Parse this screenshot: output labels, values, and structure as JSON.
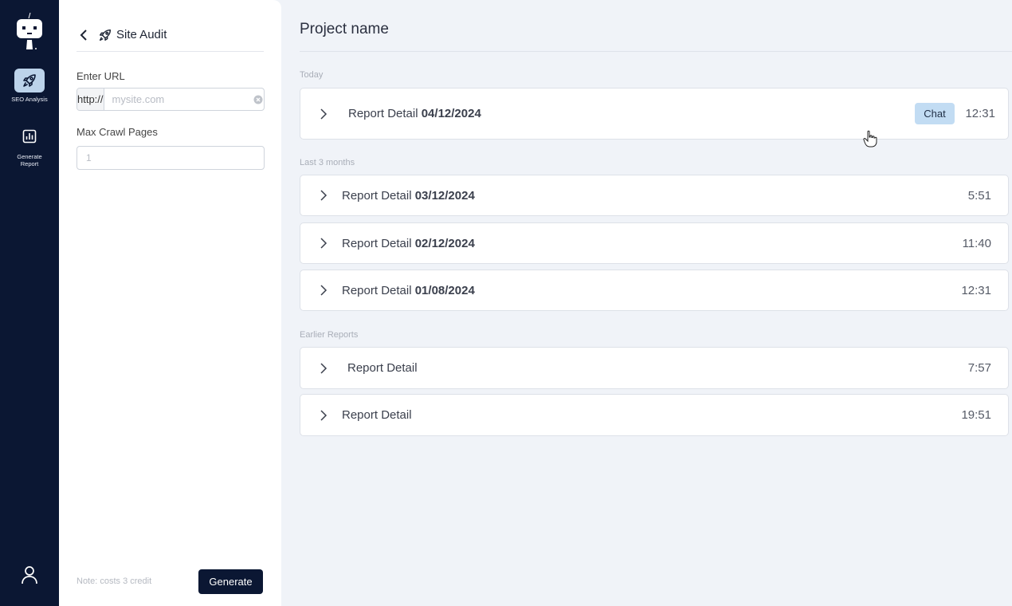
{
  "rail": {
    "items": [
      {
        "label": "SEO Analysis",
        "icon": "rocket-icon"
      },
      {
        "label": "Generate Report",
        "icon": "bar-chart-icon"
      }
    ],
    "user_icon": "user-icon",
    "accent": "#bcd3ea",
    "background": "#0b1733"
  },
  "panel": {
    "title": "Site Audit",
    "url_label": "Enter URL",
    "url_prefix": "http://",
    "url_placeholder": "mysite.com",
    "url_value": "",
    "crawl_label": "Max Crawl Pages",
    "crawl_placeholder": "1",
    "note": "Note: costs 3 credit",
    "generate_label": "Generate"
  },
  "main": {
    "title": "Project name",
    "sections": [
      {
        "label": "Today"
      },
      {
        "label": "Last 3 months"
      },
      {
        "label": "Earlier Reports"
      }
    ],
    "reports": [
      {
        "label": "Report Detail",
        "date": "04/12/2024",
        "time": "12:31",
        "chat": "Chat"
      },
      {
        "label": "Report Detail",
        "date": "03/12/2024",
        "time": "5:51"
      },
      {
        "label": "Report Detail",
        "date": "02/12/2024",
        "time": "11:40"
      },
      {
        "label": "Report Detail",
        "date": "01/08/2024",
        "time": "12:31"
      },
      {
        "label": "Report Detail",
        "date": "",
        "time": "7:57"
      },
      {
        "label": "Report Detail",
        "date": "",
        "time": "19:51"
      }
    ]
  }
}
